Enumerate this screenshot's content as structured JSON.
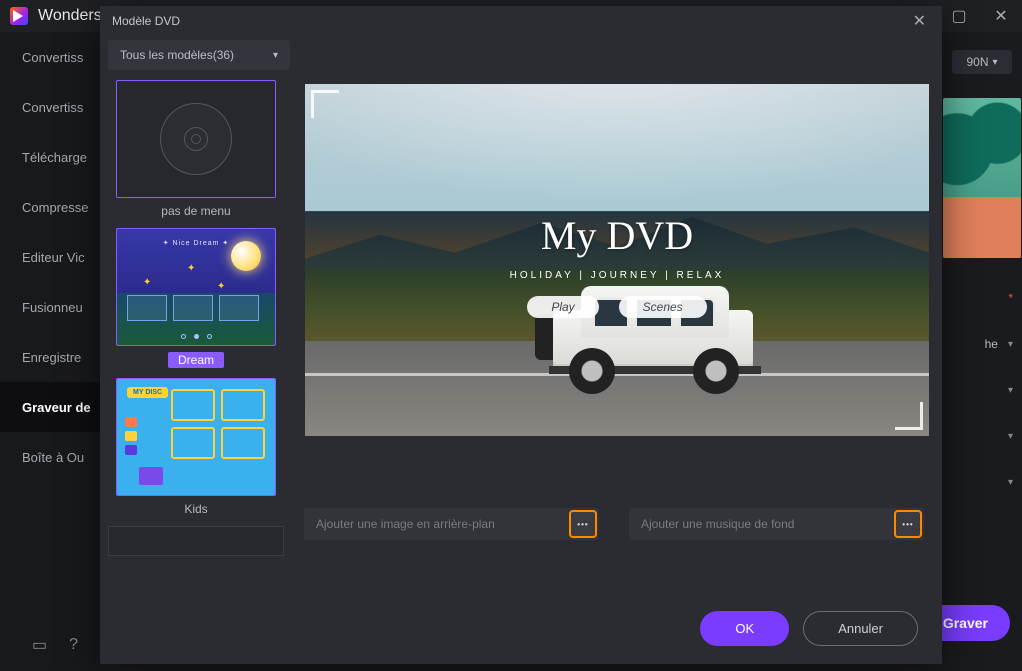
{
  "app": {
    "title": "Wonders"
  },
  "window_controls": {
    "min": "—",
    "max": "▢",
    "close": "✕"
  },
  "sidebar": {
    "items": [
      {
        "label": "Convertiss"
      },
      {
        "label": "Convertiss"
      },
      {
        "label": "Télécharge"
      },
      {
        "label": "Compresse"
      },
      {
        "label": "Editeur Vic"
      },
      {
        "label": "Fusionneu"
      },
      {
        "label": "Enregistre"
      },
      {
        "label": "Graveur de"
      },
      {
        "label": "Boîte à Ou"
      }
    ],
    "active_index": 7
  },
  "background": {
    "right_select": "90N",
    "right_rows": [
      {
        "text": "he",
        "required": false
      },
      {
        "text": "",
        "required": true
      },
      {
        "text": "",
        "required": false
      },
      {
        "text": "",
        "required": false
      }
    ],
    "graver": "Graver"
  },
  "modal": {
    "title": "Modèle DVD",
    "close": "✕",
    "template_select": "Tous les modèles(36)",
    "templates": [
      {
        "label": "pas de menu"
      },
      {
        "label": "Dream",
        "header": "✦ Nice Dream ✦"
      },
      {
        "label": "Kids",
        "badge": "MY DISC"
      }
    ],
    "selected_index": 1,
    "preview": {
      "title": "My DVD",
      "tags": "HOLIDAY  |  JOURNEY  |  RELAX",
      "play": "Play",
      "scenes": "Scenes"
    },
    "bg_image_placeholder": "Ajouter une image en arrière-plan",
    "bg_music_placeholder": "Ajouter une musique de fond",
    "browse_glyph": "•••",
    "ok": "OK",
    "cancel": "Annuler"
  }
}
